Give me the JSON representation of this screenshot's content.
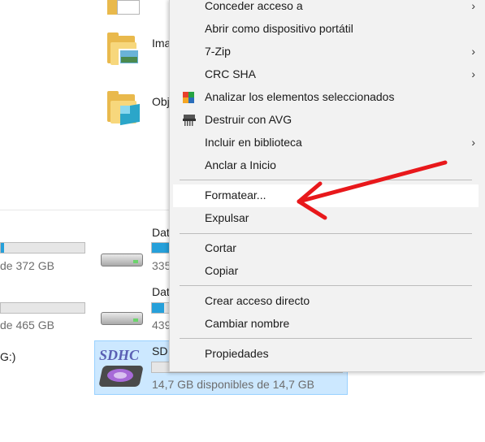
{
  "explorer": {
    "folders": [
      {
        "label": "Ima"
      },
      {
        "label": "Obj"
      }
    ],
    "drives_left": [
      {
        "free_text": "de 372 GB"
      },
      {
        "free_text": "de 465 GB"
      },
      {
        "free_text": "G:)"
      }
    ],
    "drives_right": [
      {
        "name": "Dat",
        "free_text": "335"
      },
      {
        "name": "Dat",
        "free_text": "439"
      },
      {
        "name": "SD",
        "badge": "SDHC",
        "free_text": "14,7 GB disponibles de 14,7 GB"
      }
    ],
    "colors": {
      "selection": "#cce8ff",
      "bar_fill": "#26a0da"
    }
  },
  "menu": {
    "items": [
      {
        "label": "Conceder acceso a",
        "submenu": true
      },
      {
        "label": "Abrir como dispositivo portátil",
        "submenu": false
      },
      {
        "label": "7-Zip",
        "submenu": true
      },
      {
        "label": "CRC SHA",
        "submenu": true
      },
      {
        "label": "Analizar los elementos seleccionados",
        "icon": "avg-scan-icon"
      },
      {
        "label": "Destruir con AVG",
        "icon": "shredder-icon"
      },
      {
        "label": "Incluir en biblioteca",
        "submenu": true
      },
      {
        "label": "Anclar a Inicio"
      },
      {
        "label": "Formatear..."
      },
      {
        "label": "Expulsar"
      },
      {
        "label": "Cortar"
      },
      {
        "label": "Copiar"
      },
      {
        "label": "Crear acceso directo"
      },
      {
        "label": "Cambiar nombre"
      },
      {
        "label": "Propiedades"
      }
    ],
    "chevron": "›"
  },
  "annotation": {
    "color": "#e8181b",
    "points_to": "Formatear..."
  }
}
